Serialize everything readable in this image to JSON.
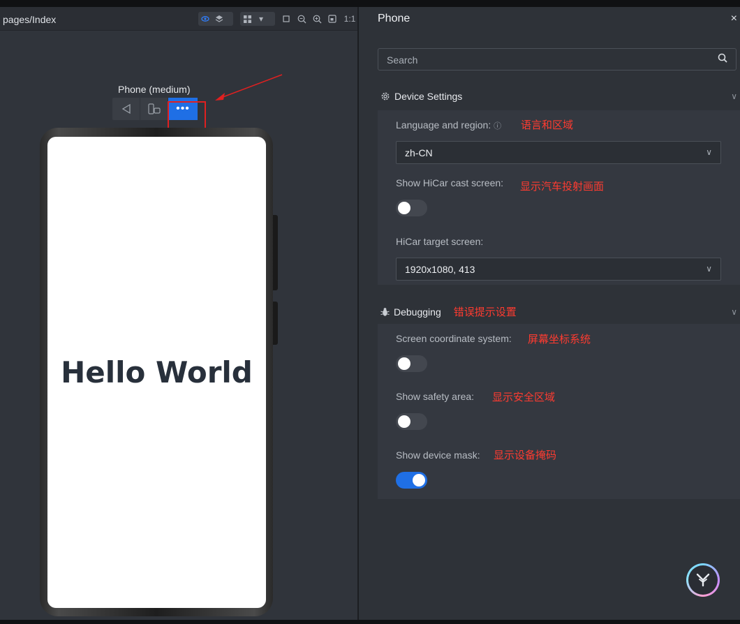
{
  "left": {
    "page_path": "pages/Index",
    "toolbar_zoom_label": "1:1",
    "device_name": "Phone (medium)",
    "more_glyph": "•••",
    "hello_text": "Hello World"
  },
  "right": {
    "title": "Phone",
    "close_glyph": "×",
    "search_placeholder": "Search",
    "device_settings": {
      "title": "Device Settings",
      "language_label": "Language and region:",
      "language_anno": "语言和区域",
      "language_value": "zh-CN",
      "hicar_cast_label": "Show HiCar cast screen:",
      "hicar_cast_anno": "显示汽车投射画面",
      "hicar_cast_on": false,
      "hicar_target_label": "HiCar target screen:",
      "hicar_target_value": "1920x1080, 413"
    },
    "debugging": {
      "title": "Debugging",
      "title_anno": "错误提示设置",
      "coord_label": "Screen coordinate system:",
      "coord_anno": "屏幕坐标系统",
      "coord_on": false,
      "safety_label": "Show safety area:",
      "safety_anno": "显示安全区域",
      "safety_on": false,
      "mask_label": "Show device mask:",
      "mask_anno": "显示设备掩码",
      "mask_on": true
    }
  },
  "colors": {
    "accent": "#1f6fe5",
    "annotation": "#ff3b30",
    "panel_bg": "#2e3238"
  }
}
